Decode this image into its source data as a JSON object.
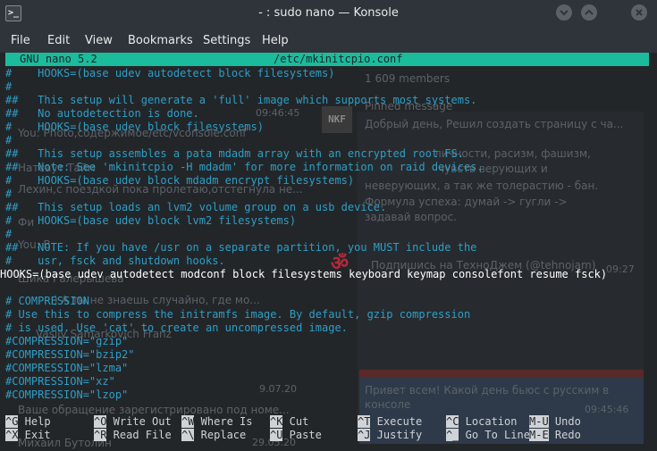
{
  "window": {
    "title": "- : sudo nano — Konsole",
    "app_icon_glyph": ">_",
    "min_glyph": "v",
    "max_glyph": "^",
    "close_glyph": "x"
  },
  "menu": [
    "File",
    "Edit",
    "View",
    "Bookmarks",
    "Settings",
    "Help"
  ],
  "nano": {
    "version": "GNU nano 5.2",
    "file_path": "/etc/mkinitcpio.conf",
    "lines": [
      {
        "text": "#    HOOKS=(base udev autodetect block filesystems)",
        "style": "comment"
      },
      {
        "text": "#",
        "style": "comment"
      },
      {
        "text": "##   This setup will generate a 'full' image which supports most systems.",
        "style": "comment"
      },
      {
        "text": "##   No autodetection is done.",
        "style": "comment"
      },
      {
        "text": "#    HOOKS=(base udev block filesystems)",
        "style": "comment"
      },
      {
        "text": "#",
        "style": "comment"
      },
      {
        "text": "##   This setup assembles a pata mdadm array with an encrypted root FS.",
        "style": "comment"
      },
      {
        "text": "##   Note: See 'mkinitcpio -H mdadm' for more information on raid devices.",
        "style": "comment"
      },
      {
        "text": "#    HOOKS=(base udev block mdadm encrypt filesystems)",
        "style": "comment"
      },
      {
        "text": "#",
        "style": "comment"
      },
      {
        "text": "##   This setup loads an lvm2 volume group on a usb device.",
        "style": "comment"
      },
      {
        "text": "#    HOOKS=(base udev block lvm2 filesystems)",
        "style": "comment"
      },
      {
        "text": "#",
        "style": "comment"
      },
      {
        "text": "##   NOTE: If you have /usr on a separate partition, you MUST include the",
        "style": "comment"
      },
      {
        "text": "#    usr, fsck and shutdown hooks.",
        "style": "comment"
      },
      {
        "text": "HOOKS=(base udev autodetect modconf block filesystems keyboard keymap consolefont resume fsck)",
        "style": "hooks"
      },
      {
        "text": "",
        "style": "normal"
      },
      {
        "text": "# COMPRESSION",
        "style": "comment"
      },
      {
        "text": "# Use this to compress the initramfs image. By default, gzip compression",
        "style": "comment"
      },
      {
        "text": "# is used. Use 'cat' to create an uncompressed image.",
        "style": "comment"
      },
      {
        "text": "#COMPRESSION=\"gzip\"",
        "style": "comment"
      },
      {
        "text": "#COMPRESSION=\"bzip2\"",
        "style": "comment"
      },
      {
        "text": "#COMPRESSION=\"lzma\"",
        "style": "comment"
      },
      {
        "text": "#COMPRESSION=\"xz\"",
        "style": "comment"
      },
      {
        "text": "#COMPRESSION=\"lzop\"",
        "style": "comment"
      }
    ],
    "shortcuts": [
      {
        "key": "^G",
        "label": " Help"
      },
      {
        "key": "^O",
        "label": " Write Out"
      },
      {
        "key": "^W",
        "label": " Where Is"
      },
      {
        "key": "^K",
        "label": " Cut"
      },
      {
        "key": "^T",
        "label": " Execute"
      },
      {
        "key": "^C",
        "label": " Location"
      },
      {
        "key": "M-U",
        "label": " Undo"
      },
      {
        "key": "^X",
        "label": " Exit"
      },
      {
        "key": "^R",
        "label": " Read File"
      },
      {
        "key": "^\\",
        "label": " Replace"
      },
      {
        "key": "^U",
        "label": " Paste"
      },
      {
        "key": "^J",
        "label": " Justify"
      },
      {
        "key": "^_",
        "label": " Go To Line"
      },
      {
        "key": "M-E",
        "label": " Redo"
      }
    ]
  },
  "background_ghost": {
    "members": "1 609 members",
    "pinned_title": "Pinned message",
    "pinned_text": "Добрый день, Решил создать страницу с ча...",
    "rules_1": "личности, расизм, фашизм,",
    "rules_2": "чувств верующих и",
    "rules_3": "неверующих, а так же толерастию - бан.",
    "rules_4": "Формула успеха: думай -> гугли ->",
    "rules_5": "задавай вопрос.",
    "subscribe": "Подпишись на ТехноДжем (@tehnojam)",
    "time_1": "09:46:45",
    "time_2": "09:27",
    "time_3": "09:45:46",
    "time_4": "9.07.20",
    "time_5": "29.05.20",
    "chat_1": "You: Photo,содержимое/etc/vconsole.conf",
    "chat_2": "Натсаут Тайм",
    "chat_3": "Лехин,с поездкой пока пролетаю,отстегнула не...",
    "chat_4": "Фи",
    "chat_5": "You: В",
    "chat_6": "Шика Галерышева",
    "chat_7": ") А ты не знаешь случайно, где мо...",
    "chat_8": "Vasily Samarkovich Franz",
    "chat_9": "Ваше обращение зарегистрировано под номе...",
    "chat_10": "Михаил Бутолин",
    "greeting": "Привет всем! Какой день бьюс с русским в",
    "greeting_2": "консоле",
    "nkf": "NKF"
  }
}
